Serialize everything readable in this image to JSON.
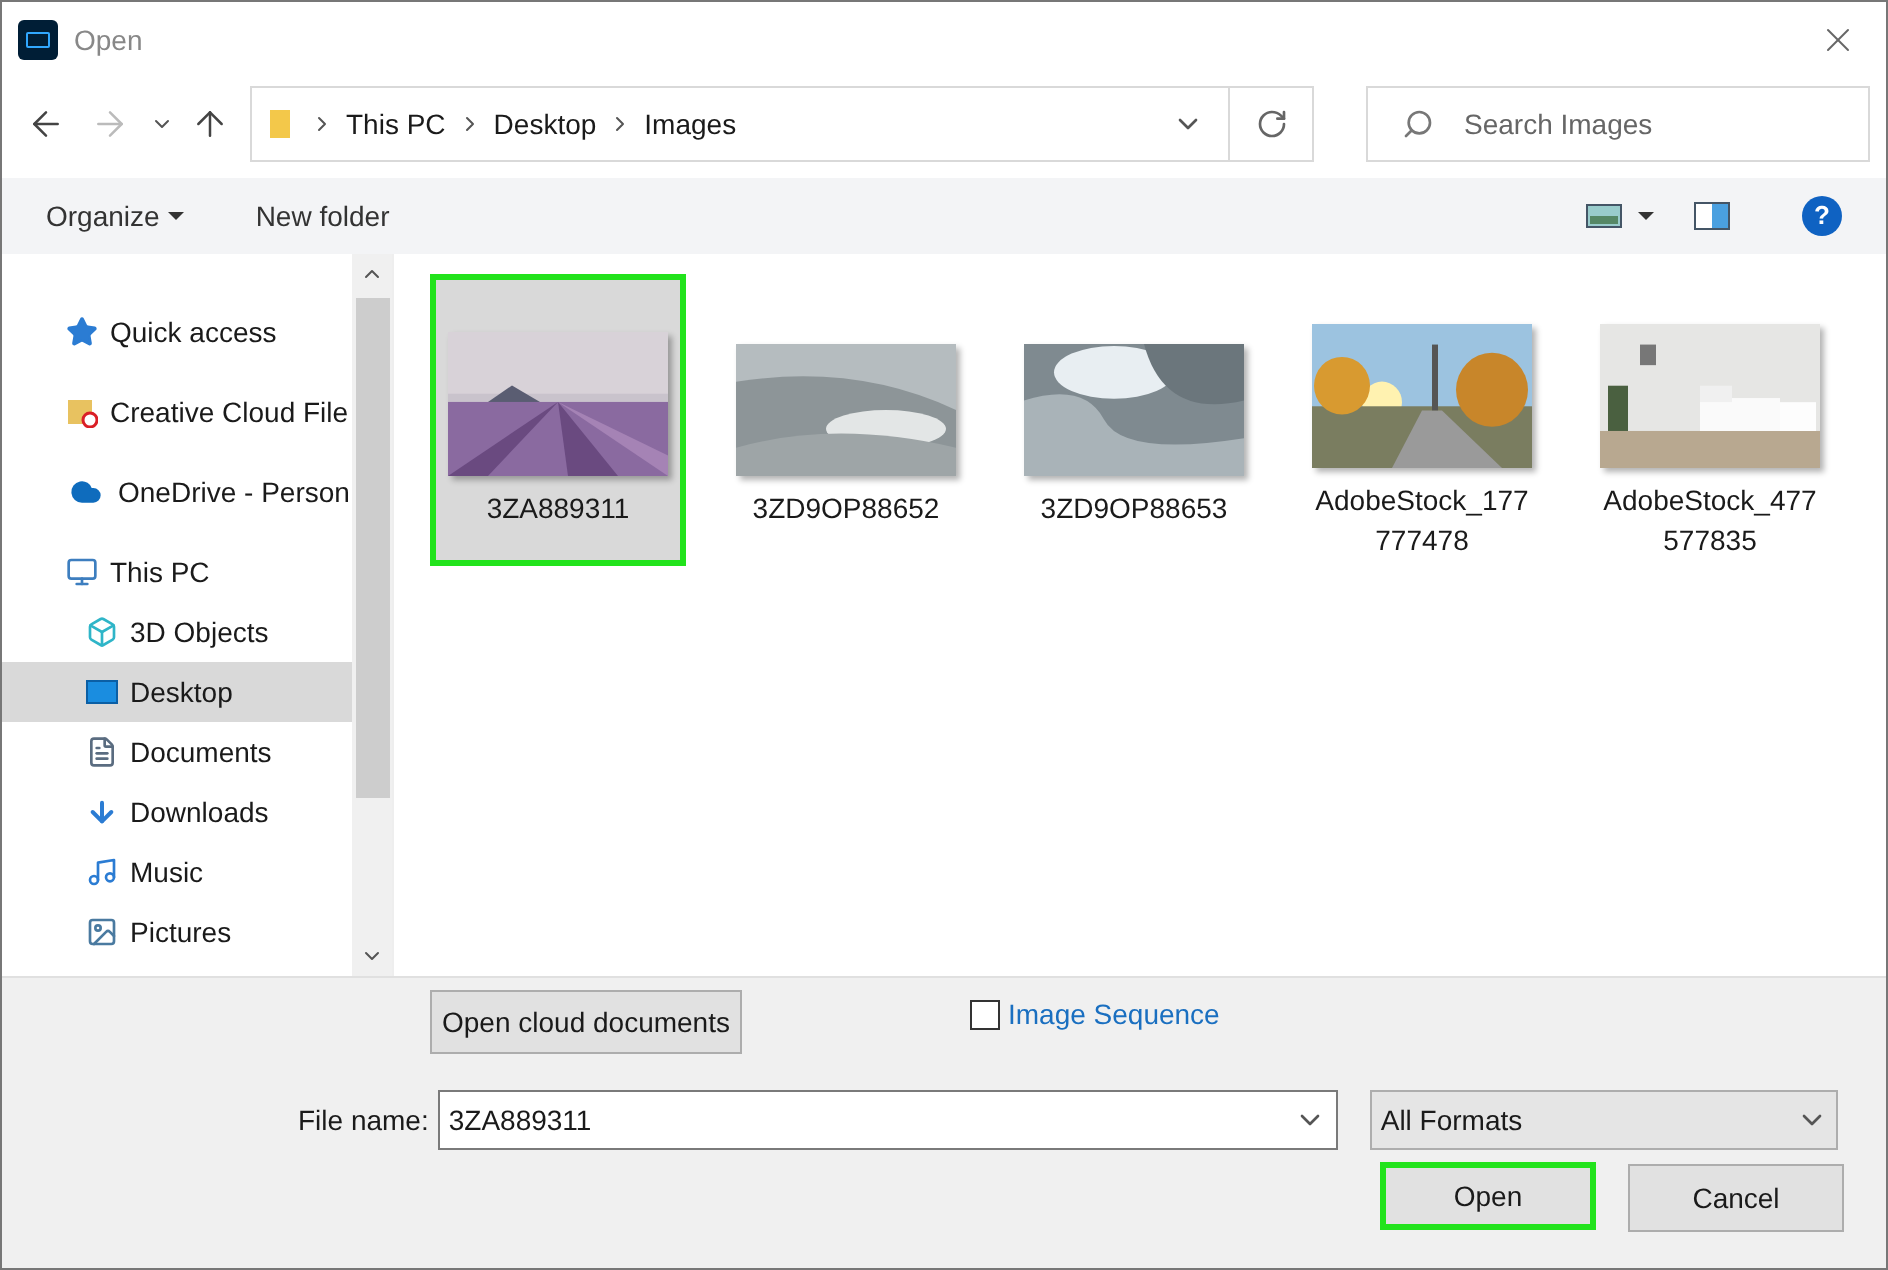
{
  "window": {
    "title": "Open"
  },
  "address": {
    "crumbs": [
      "This PC",
      "Desktop",
      "Images"
    ]
  },
  "search": {
    "placeholder": "Search Images"
  },
  "toolbar": {
    "organize": "Organize",
    "new_folder": "New folder",
    "help": "?"
  },
  "sidebar": {
    "items": [
      {
        "label": "Quick access",
        "selected": false
      },
      {
        "label": "Creative Cloud File",
        "selected": false
      },
      {
        "label": "OneDrive - Person",
        "selected": false
      },
      {
        "label": "This PC",
        "selected": false,
        "children": [
          {
            "label": "3D Objects",
            "selected": false
          },
          {
            "label": "Desktop",
            "selected": true
          },
          {
            "label": "Documents",
            "selected": false
          },
          {
            "label": "Downloads",
            "selected": false
          },
          {
            "label": "Music",
            "selected": false
          },
          {
            "label": "Pictures",
            "selected": false
          }
        ]
      }
    ]
  },
  "files": [
    {
      "name": "3ZA889311",
      "selected": true,
      "highlighted": true,
      "kind": "picture"
    },
    {
      "name": "3ZD9OP88652",
      "selected": false,
      "highlighted": false,
      "kind": "picture"
    },
    {
      "name": "3ZD9OP88653",
      "selected": false,
      "highlighted": false,
      "kind": "picture"
    },
    {
      "name": "AdobeStock_177 777478",
      "selected": false,
      "highlighted": false,
      "kind": "picture"
    },
    {
      "name": "AdobeStock_477 577835",
      "selected": false,
      "highlighted": false,
      "kind": "picture"
    }
  ],
  "cloud_button": "Open cloud documents",
  "image_sequence": {
    "label": "Image Sequence",
    "checked": false
  },
  "file_name": {
    "label": "File name:",
    "value": "3ZA889311"
  },
  "format": {
    "value": "All Formats"
  },
  "buttons": [
    {
      "label": "Open",
      "highlighted": true
    },
    {
      "label": "Cancel",
      "highlighted": false
    }
  ]
}
